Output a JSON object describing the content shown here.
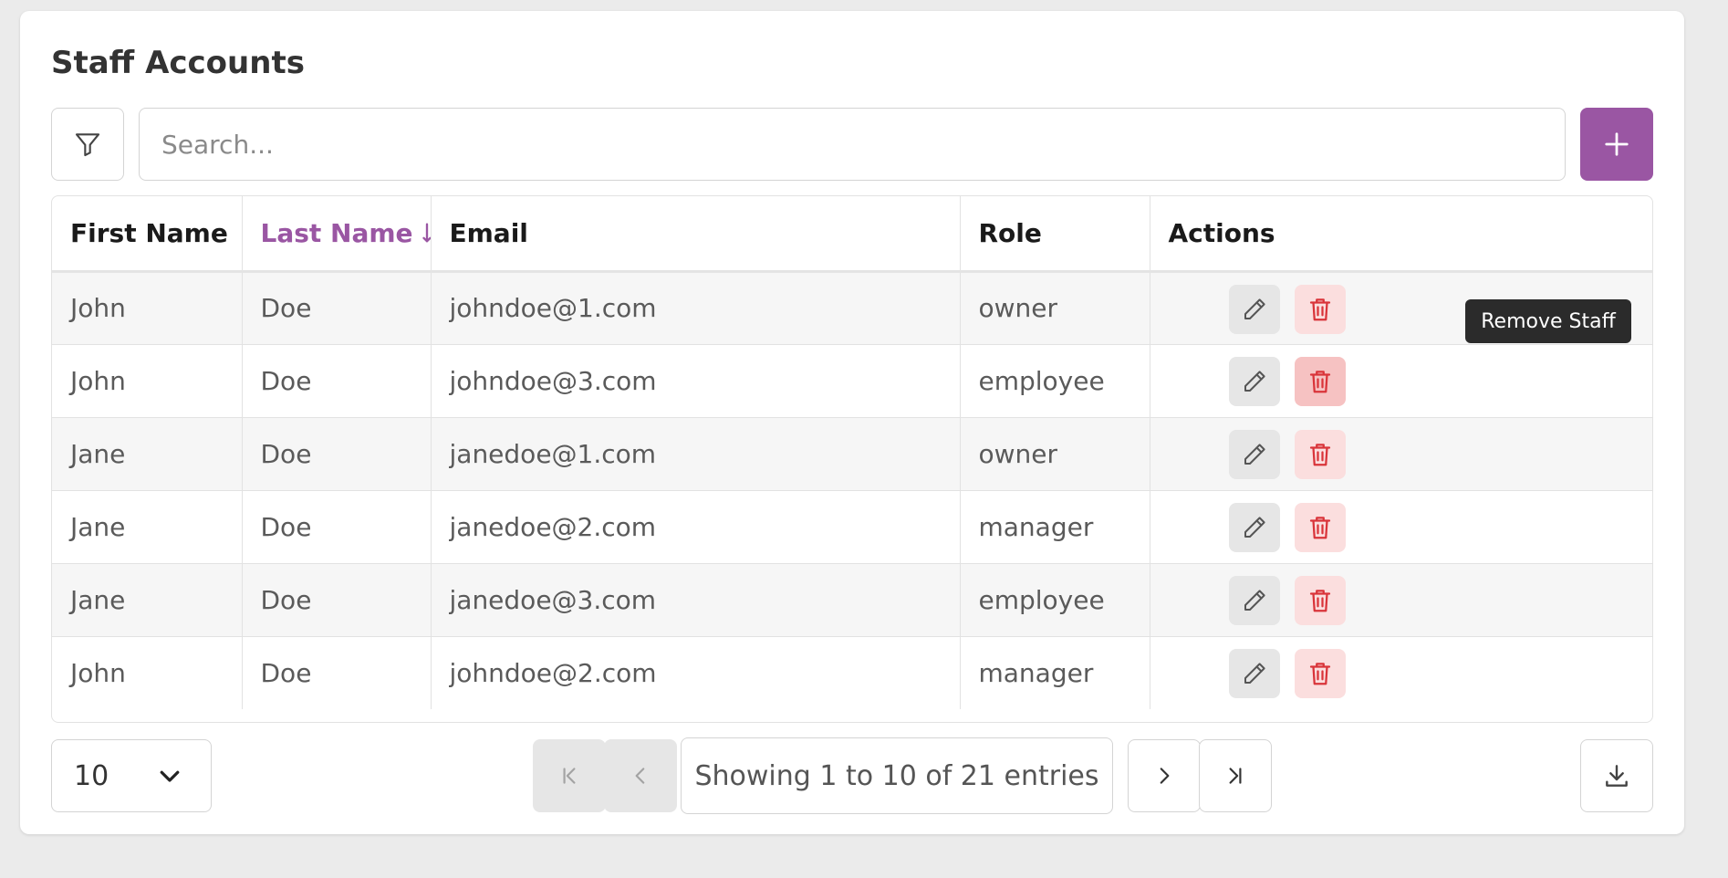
{
  "page": {
    "title": "Staff Accounts"
  },
  "toolbar": {
    "filter_icon": "filter-icon",
    "search_placeholder": "Search...",
    "search_value": "",
    "add_icon": "plus-icon"
  },
  "table": {
    "columns": [
      {
        "label": "First Name"
      },
      {
        "label": "Last Name",
        "sorted": "descending"
      },
      {
        "label": "Email"
      },
      {
        "label": "Role"
      },
      {
        "label": "Actions"
      }
    ],
    "rows": [
      {
        "first": "John",
        "last": "Doe",
        "email": "johndoe@1.com",
        "role": "owner"
      },
      {
        "first": "John",
        "last": "Doe",
        "email": "johndoe@3.com",
        "role": "employee"
      },
      {
        "first": "Jane",
        "last": "Doe",
        "email": "janedoe@1.com",
        "role": "owner"
      },
      {
        "first": "Jane",
        "last": "Doe",
        "email": "janedoe@2.com",
        "role": "manager"
      },
      {
        "first": "Jane",
        "last": "Doe",
        "email": "janedoe@3.com",
        "role": "employee"
      },
      {
        "first": "John",
        "last": "Doe",
        "email": "johndoe@2.com",
        "role": "manager"
      }
    ],
    "tooltip": "Remove Staff"
  },
  "pagination": {
    "page_size": "10",
    "info": "Showing 1 to 10 of 21 entries"
  },
  "colors": {
    "accent": "#9a56a3",
    "danger": "#d9343a",
    "danger_bg": "#fbdede"
  }
}
